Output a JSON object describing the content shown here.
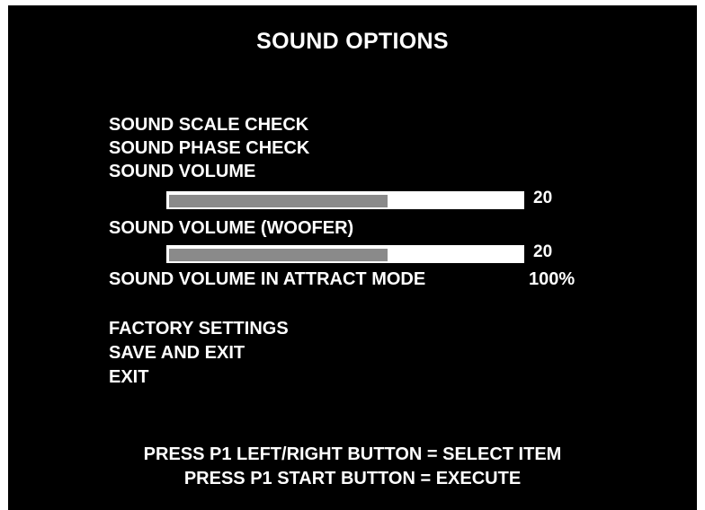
{
  "title": "SOUND OPTIONS",
  "menu": {
    "scale_check": "SOUND SCALE CHECK",
    "phase_check": "SOUND PHASE CHECK",
    "volume": {
      "label": "SOUND VOLUME",
      "value": "20",
      "fill_fraction": 0.62
    },
    "woofer_volume": {
      "label": "SOUND VOLUME (WOOFER)",
      "value": "20",
      "fill_fraction": 0.62
    },
    "attract_volume": {
      "label": "SOUND VOLUME IN ATTRACT MODE",
      "value": "100%"
    },
    "factory_settings": "FACTORY SETTINGS",
    "save_and_exit": "SAVE AND EXIT",
    "exit": "EXIT"
  },
  "footer": {
    "line1": "PRESS P1 LEFT/RIGHT BUTTON = SELECT ITEM",
    "line2": "PRESS P1 START BUTTON = EXECUTE"
  },
  "colors": {
    "background": "#000000",
    "text": "#ffffff",
    "bar_track": "#ffffff",
    "bar_fill": "#8a8a8a"
  }
}
